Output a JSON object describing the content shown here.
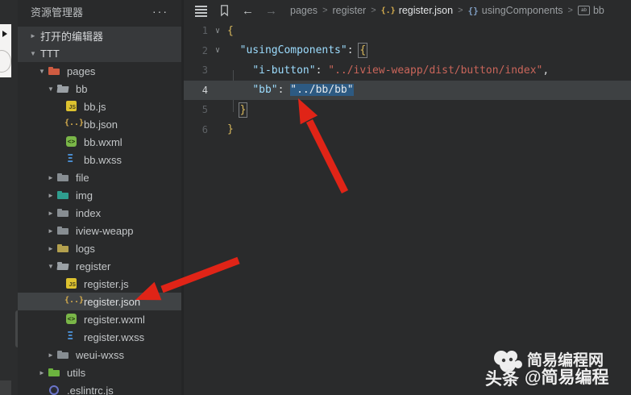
{
  "sidebar": {
    "title": "资源管理器",
    "more_label": "···",
    "sections": [
      {
        "label": "打开的编辑器",
        "chevron": "right"
      },
      {
        "label": "TTT",
        "chevron": "down"
      }
    ],
    "tree": [
      {
        "label": "pages",
        "icon": "folder-pages",
        "level": 1,
        "chevron": "down"
      },
      {
        "label": "bb",
        "icon": "folder-open",
        "level": 2,
        "chevron": "down"
      },
      {
        "label": "bb.js",
        "icon": "js",
        "level": 3
      },
      {
        "label": "bb.json",
        "icon": "json",
        "level": 3
      },
      {
        "label": "bb.wxml",
        "icon": "wxml",
        "level": 3
      },
      {
        "label": "bb.wxss",
        "icon": "wxss",
        "level": 3
      },
      {
        "label": "file",
        "icon": "folder",
        "level": 2,
        "chevron": "right"
      },
      {
        "label": "img",
        "icon": "folder-img",
        "level": 2,
        "chevron": "right"
      },
      {
        "label": "index",
        "icon": "folder",
        "level": 2,
        "chevron": "right"
      },
      {
        "label": "iview-weapp",
        "icon": "folder",
        "level": 2,
        "chevron": "right"
      },
      {
        "label": "logs",
        "icon": "folder-logs",
        "level": 2,
        "chevron": "right"
      },
      {
        "label": "register",
        "icon": "folder-open",
        "level": 2,
        "chevron": "down"
      },
      {
        "label": "register.js",
        "icon": "js",
        "level": 3
      },
      {
        "label": "register.json",
        "icon": "json",
        "level": 3,
        "selected": true
      },
      {
        "label": "register.wxml",
        "icon": "wxml",
        "level": 3
      },
      {
        "label": "register.wxss",
        "icon": "wxss",
        "level": 3
      },
      {
        "label": "weui-wxss",
        "icon": "folder",
        "level": 2,
        "chevron": "right"
      },
      {
        "label": "utils",
        "icon": "folder-utils",
        "level": 1,
        "chevron": "right"
      },
      {
        "label": ".eslintrc.js",
        "icon": "eslint",
        "level": 1
      }
    ]
  },
  "editor": {
    "toolbar": [
      {
        "name": "outline-icon"
      },
      {
        "name": "bookmark-icon"
      },
      {
        "name": "back-arrow-icon",
        "glyph": "←"
      },
      {
        "name": "forward-arrow-icon",
        "glyph": "→",
        "disabled": true
      }
    ],
    "breadcrumbs": [
      {
        "label": "pages"
      },
      {
        "label": "register"
      },
      {
        "label": "register.json",
        "icon": "json-file-icon",
        "bright": true
      },
      {
        "label": "usingComponents",
        "icon": "object-icon"
      },
      {
        "label": "bb",
        "icon": "field-icon"
      }
    ],
    "code_lines": [
      {
        "num": "1",
        "fold": true,
        "tokens": [
          {
            "t": "{",
            "c": "brace"
          }
        ]
      },
      {
        "num": "2",
        "fold": true,
        "tokens": [
          {
            "t": "  ",
            "c": "ws"
          },
          {
            "t": "\"usingComponents\"",
            "c": "key"
          },
          {
            "t": ": ",
            "c": "pun"
          },
          {
            "t": "{",
            "c": "brace match"
          }
        ]
      },
      {
        "num": "3",
        "tokens": [
          {
            "t": "    ",
            "c": "ws"
          },
          {
            "t": "\"i-button\"",
            "c": "key"
          },
          {
            "t": ": ",
            "c": "pun"
          },
          {
            "t": "\"../iview-weapp/dist/button/index\"",
            "c": "str"
          },
          {
            "t": ",",
            "c": "pun"
          }
        ]
      },
      {
        "num": "4",
        "current": true,
        "tokens": [
          {
            "t": "    ",
            "c": "ws"
          },
          {
            "t": "\"bb\"",
            "c": "key"
          },
          {
            "t": ": ",
            "c": "pun"
          },
          {
            "t": "\"../bb/bb\"",
            "c": "str sel"
          }
        ]
      },
      {
        "num": "5",
        "tokens": [
          {
            "t": "  ",
            "c": "ws"
          },
          {
            "t": "}",
            "c": "brace match"
          }
        ]
      },
      {
        "num": "6",
        "tokens": [
          {
            "t": "}",
            "c": "brace"
          }
        ]
      }
    ]
  },
  "watermark": {
    "line1": "简易编程网",
    "line2_prefix": "头条",
    "line2": "@简易编程"
  },
  "colors": {
    "arrow_red": "#e02417",
    "selection_blue": "#2d5a82",
    "current_line": "#3e4143",
    "key_blue": "#9cdcfe",
    "string_red": "#c9655a",
    "brace_gold": "#d9b95c",
    "selected_row": "#404345",
    "sidebar_bg": "#292a2b",
    "editor_bg": "#2a2b2c"
  }
}
